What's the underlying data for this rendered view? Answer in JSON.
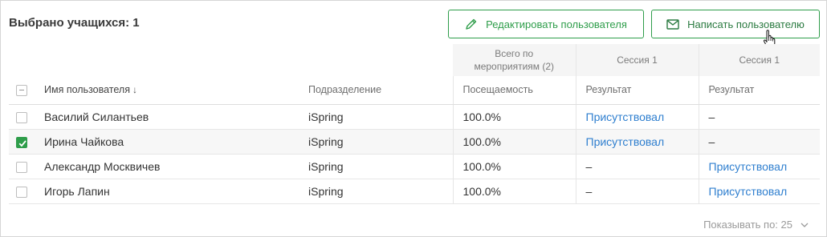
{
  "header": {
    "selected_label": "Выбрано учащихся: 1",
    "edit_button_label": "Редактировать пользователя",
    "write_button_label": "Написать пользователю"
  },
  "table": {
    "group_headers": {
      "total": "Всего по мероприятиям (2)",
      "session1_a": "Сессия 1",
      "session1_b": "Сессия 1"
    },
    "columns": {
      "name": "Имя пользователя",
      "department": "Подразделение",
      "attendance": "Посещаемость",
      "result_a": "Результат",
      "result_b": "Результат"
    },
    "rows": [
      {
        "name": "Василий Силантьев",
        "department": "iSpring",
        "attendance": "100.0%",
        "result_a": "Присутствовал",
        "result_b": "–",
        "checked": false
      },
      {
        "name": "Ирина Чайкова",
        "department": "iSpring",
        "attendance": "100.0%",
        "result_a": "Присутствовал",
        "result_b": "–",
        "checked": true
      },
      {
        "name": "Александр Москвичев",
        "department": "iSpring",
        "attendance": "100.0%",
        "result_a": "–",
        "result_b": "Присутствовал",
        "checked": false
      },
      {
        "name": "Игорь Лапин",
        "department": "iSpring",
        "attendance": "100.0%",
        "result_a": "–",
        "result_b": "Присутствовал",
        "checked": false
      }
    ]
  },
  "pager": {
    "label": "Показывать по: 25"
  },
  "colors": {
    "accent_green": "#2e9d4a",
    "link_blue": "#2f7fcf"
  },
  "icons": {
    "edit": "pencil-icon",
    "write": "envelope-icon",
    "sort": "arrow-down-icon",
    "pager": "chevron-down-icon",
    "cursor": "hand-pointer-icon"
  }
}
